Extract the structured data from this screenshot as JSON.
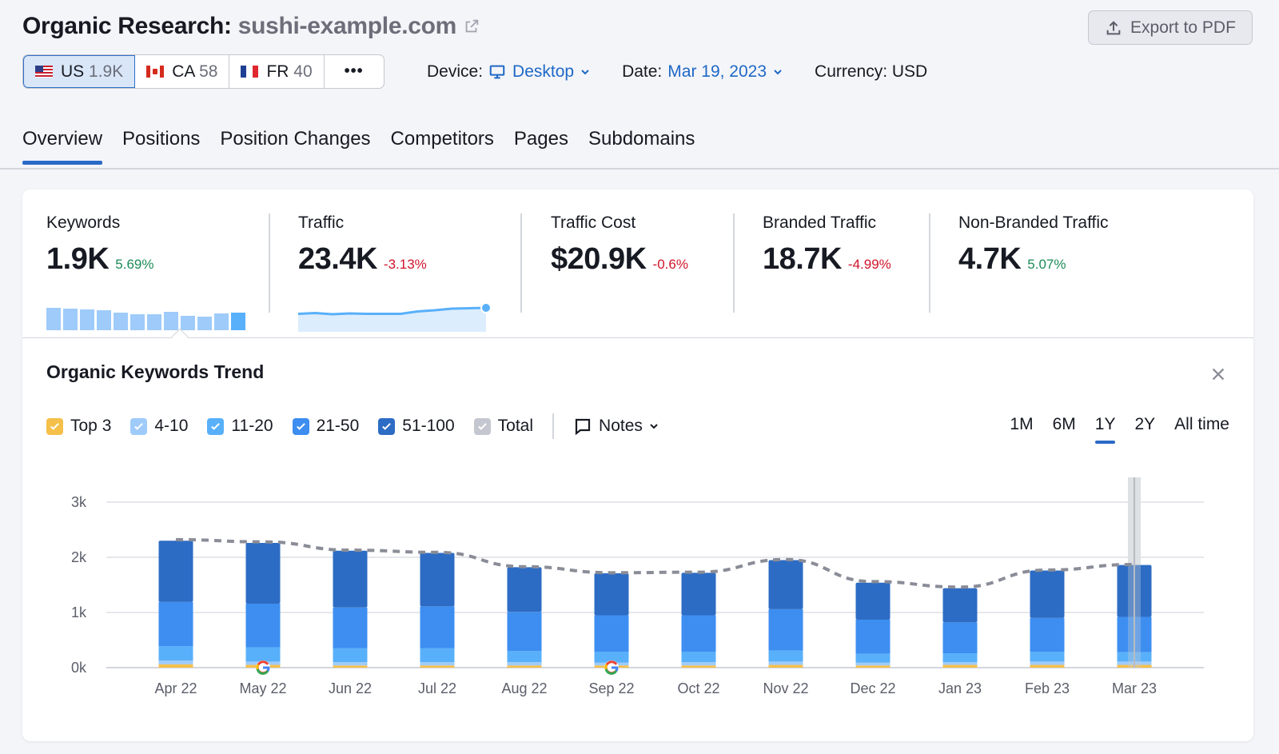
{
  "header": {
    "title": "Organic Research:",
    "domain": "sushi-example.com",
    "export_label": "Export to PDF"
  },
  "databases": [
    {
      "code": "US",
      "count": "1.9K",
      "flag": "us",
      "active": true
    },
    {
      "code": "CA",
      "count": "58",
      "flag": "ca",
      "active": false
    },
    {
      "code": "FR",
      "count": "40",
      "flag": "fr",
      "active": false
    }
  ],
  "more_label": "•••",
  "filters": {
    "device_label": "Device:",
    "device_value": "Desktop",
    "date_label": "Date:",
    "date_value": "Mar 19, 2023",
    "currency_label": "Currency: USD"
  },
  "nav_tabs": [
    "Overview",
    "Positions",
    "Position Changes",
    "Competitors",
    "Pages",
    "Subdomains"
  ],
  "active_tab": "Overview",
  "metrics": [
    {
      "label": "Keywords",
      "value": "1.9K",
      "change": "5.69%",
      "direction": "up"
    },
    {
      "label": "Traffic",
      "value": "23.4K",
      "change": "-3.13%",
      "direction": "down"
    },
    {
      "label": "Traffic Cost",
      "value": "$20.9K",
      "change": "-0.6%",
      "direction": "down"
    },
    {
      "label": "Branded Traffic",
      "value": "18.7K",
      "change": "-4.99%",
      "direction": "down"
    },
    {
      "label": "Non-Branded Traffic",
      "value": "4.7K",
      "change": "5.07%",
      "direction": "up"
    }
  ],
  "keywords_sparkline": [
    2300,
    2260,
    2120,
    2080,
    1820,
    1710,
    1720,
    1950,
    1540,
    1440,
    1760,
    1860
  ],
  "traffic_sparkline": [
    24.0,
    24.2,
    23.9,
    24.1,
    24.0,
    24.0,
    24.0,
    24.6,
    24.9,
    25.3,
    25.4,
    25.5
  ],
  "trend": {
    "title": "Organic Keywords Trend",
    "legend": [
      {
        "label": "Top 3",
        "color": "#f5c04a",
        "checked": true
      },
      {
        "label": "4-10",
        "color": "#9ecbfa",
        "checked": true
      },
      {
        "label": "11-20",
        "color": "#59b0fa",
        "checked": true
      },
      {
        "label": "21-50",
        "color": "#3d8ef0",
        "checked": true
      },
      {
        "label": "51-100",
        "color": "#2d6cc4",
        "checked": true
      },
      {
        "label": "Total",
        "color": "#c4c7cf",
        "checked": true
      }
    ],
    "notes_label": "Notes",
    "periods": [
      "1M",
      "6M",
      "1Y",
      "2Y",
      "All time"
    ],
    "active_period": "1Y"
  },
  "chart_data": {
    "type": "bar",
    "stacked": true,
    "title": "Organic Keywords Trend",
    "categories": [
      "Apr 22",
      "May 22",
      "Jun 22",
      "Jul 22",
      "Aug 22",
      "Sep 22",
      "Oct 22",
      "Nov 22",
      "Dec 22",
      "Jan 23",
      "Feb 23",
      "Mar 23"
    ],
    "series": [
      {
        "name": "Top 3",
        "color": "#f5c04a",
        "values": [
          60,
          50,
          40,
          40,
          40,
          40,
          40,
          50,
          40,
          50,
          50,
          50
        ]
      },
      {
        "name": "4-10",
        "color": "#9ecbfa",
        "values": [
          70,
          60,
          60,
          60,
          60,
          50,
          60,
          60,
          50,
          50,
          60,
          60
        ]
      },
      {
        "name": "11-20",
        "color": "#59b0fa",
        "values": [
          260,
          260,
          250,
          250,
          200,
          200,
          190,
          200,
          160,
          160,
          180,
          170
        ]
      },
      {
        "name": "21-50",
        "color": "#3d8ef0",
        "values": [
          800,
          790,
          740,
          760,
          710,
          660,
          660,
          750,
          620,
          560,
          610,
          640
        ]
      },
      {
        "name": "51-100",
        "color": "#2d6cc4",
        "values": [
          1110,
          1100,
          1030,
          970,
          810,
          760,
          770,
          890,
          670,
          620,
          860,
          940
        ]
      }
    ],
    "total": {
      "name": "Total",
      "style": "dashed",
      "color": "#8a8d97",
      "values": [
        2320,
        2280,
        2130,
        2090,
        1830,
        1720,
        1730,
        1960,
        1560,
        1460,
        1770,
        1870
      ]
    },
    "google_updates": [
      "May 22",
      "Sep 22"
    ],
    "highlighted": "Mar 23",
    "yticks": [
      "0k",
      "1k",
      "2k",
      "3k"
    ],
    "ylim": [
      0,
      3000
    ],
    "xlabel": "",
    "ylabel": "",
    "grid": true
  }
}
